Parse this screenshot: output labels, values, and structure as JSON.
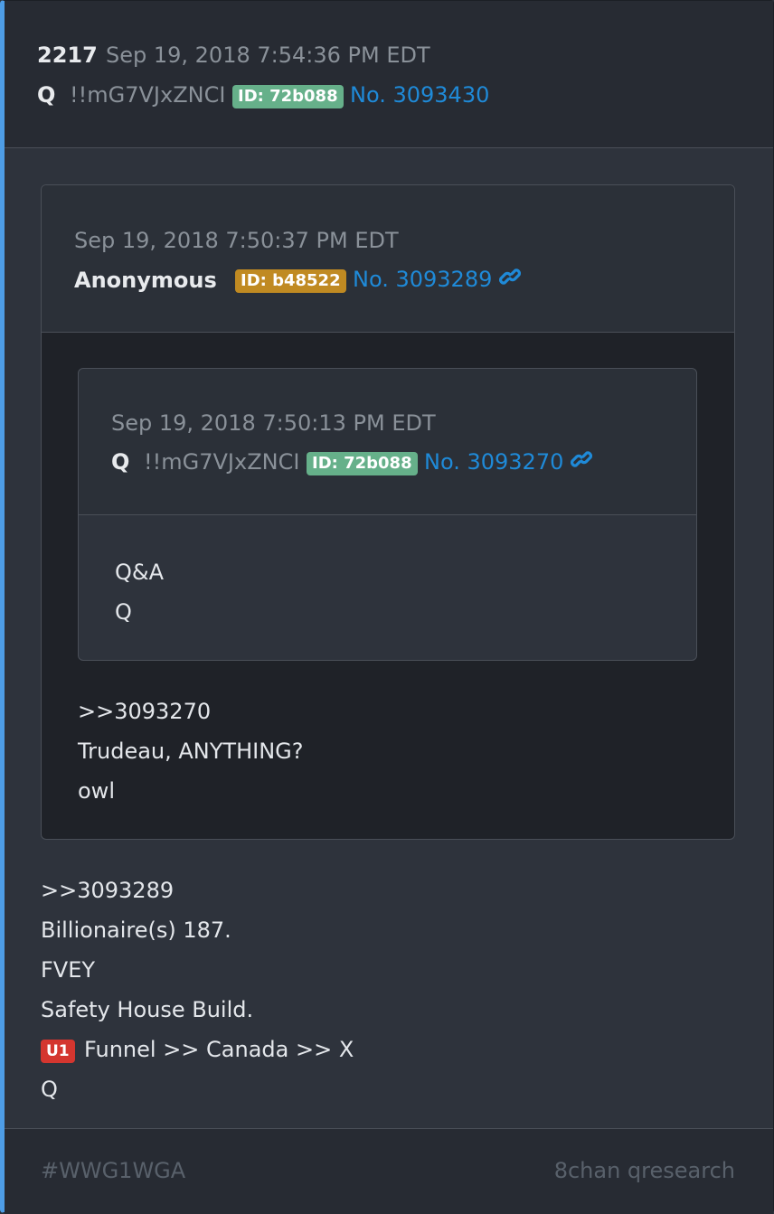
{
  "post": {
    "number": "2217",
    "date": "Sep 19, 2018 7:54:36 PM EDT",
    "author": "Q",
    "tripcode": "!!mG7VJxZNCI",
    "id_badge": "ID: 72b088",
    "post_link": "No. 3093430",
    "lines": [
      "&gt;&gt;3093289",
      "Billionaire(s) 187.",
      "FVEY",
      "Safety House Build.",
      "Funnel &gt;&gt; Canada &gt;&gt; X",
      "Q"
    ],
    "u1_badge": "U1"
  },
  "quote1": {
    "date": "Sep 19, 2018 7:50:37 PM EDT",
    "author": "Anonymous",
    "id_badge": "ID: b48522",
    "post_link": "No. 3093289",
    "lines": [
      "&gt;&gt;3093270",
      "Trudeau, ANYTHING?",
      "owl"
    ]
  },
  "quote2": {
    "date": "Sep 19, 2018 7:50:13 PM EDT",
    "author": "Q",
    "tripcode": "!!mG7VJxZNCI",
    "id_badge": "ID: 72b088",
    "post_link": "No. 3093270",
    "lines": [
      "Q&amp;A",
      "Q"
    ]
  },
  "footer": {
    "hashtag": "#WWG1WGA",
    "source": "8chan qresearch"
  },
  "colors": {
    "accent_border": "#4e9de6",
    "link": "#1f8ad8",
    "id_green": "#66b08a",
    "id_orange": "#c08a22",
    "u1_red": "#d4362f"
  }
}
